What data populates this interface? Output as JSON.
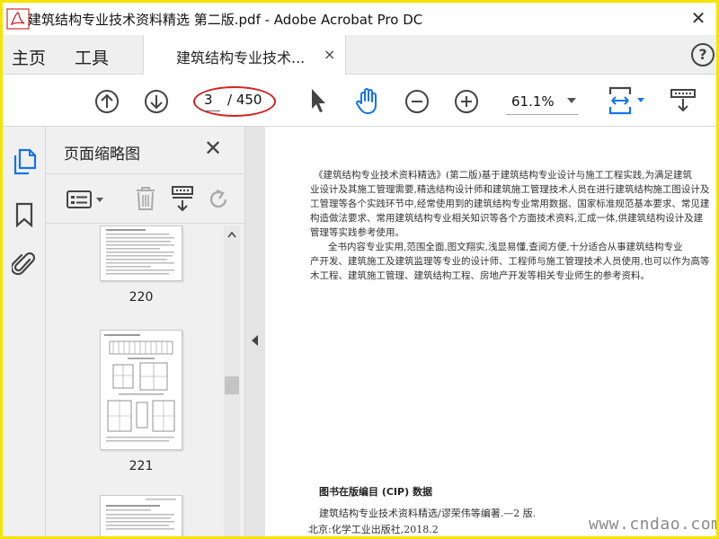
{
  "window": {
    "title": "建筑结构专业技术资料精选 第二版.pdf - Adobe Acrobat Pro DC",
    "close_glyph": "✕"
  },
  "tabs": {
    "home_label": "主页",
    "tools_label": "工具",
    "doc_tab_label": "建筑结构专业技术...",
    "doc_tab_close": "×",
    "help_glyph": "?"
  },
  "toolbar": {
    "page_current": "3",
    "page_total": "/ 450",
    "zoom_value": "61.1%"
  },
  "thumbnail_pane": {
    "title": "页面缩略图",
    "close_glyph": "✕",
    "thumbs": [
      {
        "label": "220"
      },
      {
        "label": "221"
      }
    ]
  },
  "document": {
    "para1": [
      "《建筑结构专业技术资料精选》(第二版)基于建筑结构专业设计与施工工程实践,为满足建筑",
      "业设计及其施工管理需要,精选结构设计师和建筑施工管理技术人员在进行建筑结构施工图设计及",
      "工管理等各个实践环节中,经常使用到的建筑结构专业常用数据、国家标准规范基本要求、常见建",
      "构造做法要求、常用建筑结构专业相关知识等各个方面技术资料,汇成一体,供建筑结构设计及建",
      "管理等实践参考使用。"
    ],
    "para2": [
      "全书内容专业实用,范围全面,图文翔实,浅显易懂,查阅方便,十分适合从事建筑结构专业",
      "产开发、建筑施工及建筑监理等专业的设计师、工程师与施工管理技术人员使用,也可以作为高等",
      "木工程、建筑施工管理、建筑结构工程、房地产开发等相关专业师生的参考资料。"
    ],
    "cip_heading": "图书在版编目 (CIP) 数据",
    "cip_line1": "建筑结构专业技术资料精选/谬荣伟等编著.—2 版.",
    "cip_line2": "北京:化学工业出版社,2018.2",
    "watermark": "www.cndao.com"
  },
  "colors": {
    "frame_border": "#f5e400",
    "highlight_ellipse": "#d42020",
    "hand_tool": "#1473e6",
    "active_rail_icon": "#1473e6"
  }
}
